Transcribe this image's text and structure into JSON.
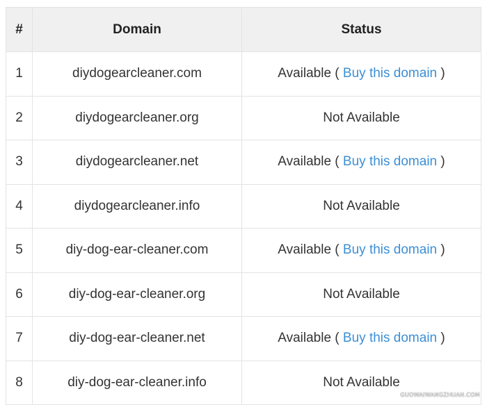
{
  "table": {
    "headers": {
      "num": "#",
      "domain": "Domain",
      "status": "Status"
    },
    "rows": [
      {
        "num": "1",
        "domain": "diydogearcleaner.com",
        "available": true,
        "status_text": "Available (",
        "link_text": "Buy this domain",
        "close_text": ")"
      },
      {
        "num": "2",
        "domain": "diydogearcleaner.org",
        "available": false,
        "status_text": "Not Available"
      },
      {
        "num": "3",
        "domain": "diydogearcleaner.net",
        "available": true,
        "status_text": "Available (",
        "link_text": "Buy this domain",
        "close_text": ")"
      },
      {
        "num": "4",
        "domain": "diydogearcleaner.info",
        "available": false,
        "status_text": "Not Available"
      },
      {
        "num": "5",
        "domain": "diy-dog-ear-cleaner.com",
        "available": true,
        "status_text": "Available (",
        "link_text": "Buy this domain",
        "close_text": ")"
      },
      {
        "num": "6",
        "domain": "diy-dog-ear-cleaner.org",
        "available": false,
        "status_text": "Not Available"
      },
      {
        "num": "7",
        "domain": "diy-dog-ear-cleaner.net",
        "available": true,
        "status_text": "Available (",
        "link_text": "Buy this domain",
        "close_text": ")"
      },
      {
        "num": "8",
        "domain": "diy-dog-ear-cleaner.info",
        "available": false,
        "status_text": "Not Available"
      }
    ]
  },
  "watermark": "GUOWAIWANGZHUAN.COM",
  "colors": {
    "link": "#3b8fd6",
    "header_bg": "#f0f0f0",
    "border": "#e3e3e3"
  }
}
